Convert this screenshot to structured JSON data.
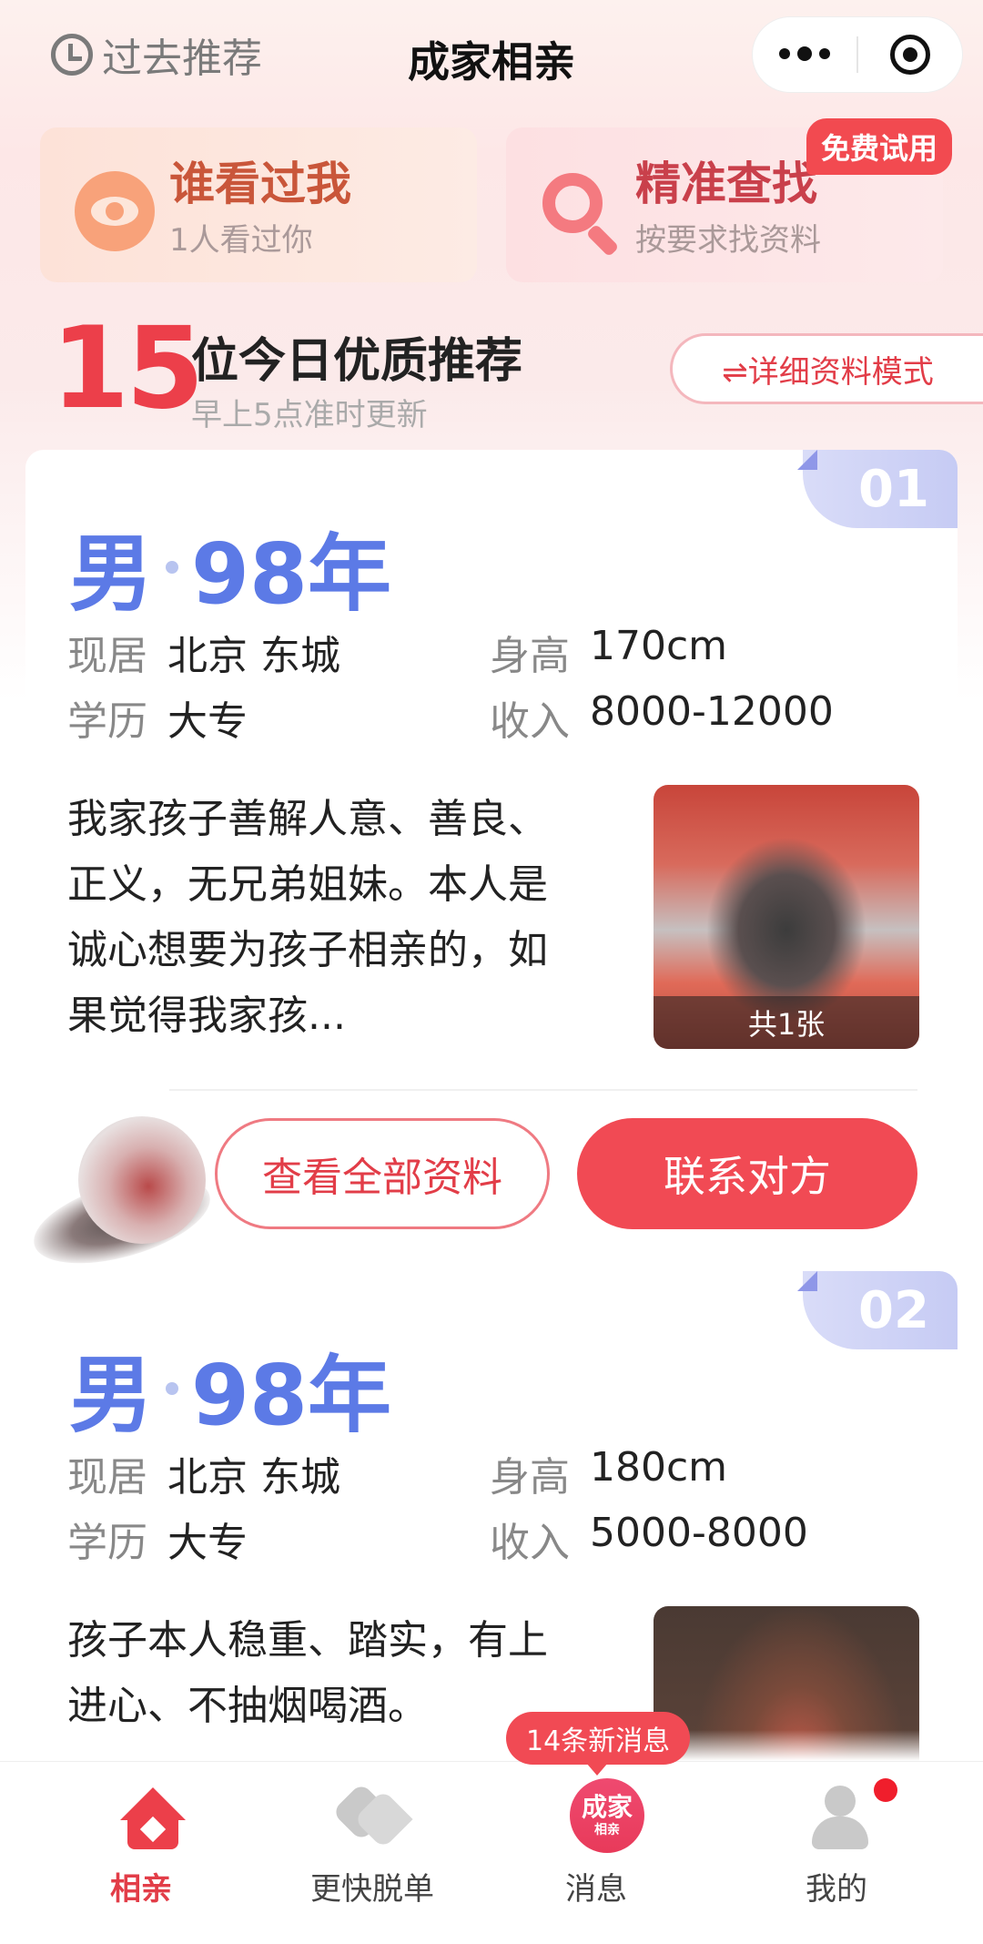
{
  "nav": {
    "past_label": "过去推荐",
    "title": "成家相亲",
    "more_icon": "more-dots-icon",
    "close_icon": "target-icon"
  },
  "features": [
    {
      "title": "谁看过我",
      "subtitle": "1人看过你",
      "icon": "eye-icon"
    },
    {
      "title": "精准查找",
      "subtitle": "按要求找资料",
      "icon": "search-icon",
      "badge": "免费试用"
    }
  ],
  "recommend": {
    "count": "15",
    "title": "位今日优质推荐",
    "subtitle": "早上5点准时更新",
    "mode_button": "⇌详细资料模式"
  },
  "profiles": [
    {
      "index": "01",
      "gender": "男",
      "year": "98年",
      "residence_label": "现居",
      "residence": "北京 东城",
      "height_label": "身高",
      "height": "170cm",
      "education_label": "学历",
      "education": "大专",
      "income_label": "收入",
      "income": "8000-12000",
      "description": "我家孩子善解人意、善良、正义，无兄弟姐妹。本人是诚心想要为孩子相亲的，如果觉得我家孩...",
      "photo_count": "共1张",
      "view_all_button": "查看全部资料",
      "contact_button": "联系对方"
    },
    {
      "index": "02",
      "gender": "男",
      "year": "98年",
      "residence_label": "现居",
      "residence": "北京 东城",
      "height_label": "身高",
      "height": "180cm",
      "education_label": "学历",
      "education": "大专",
      "income_label": "收入",
      "income": "5000-8000",
      "description": "孩子本人稳重、踏实，有上进心、不抽烟喝酒。"
    }
  ],
  "tabbar": {
    "tabs": [
      {
        "label": "相亲",
        "icon": "home-heart-icon",
        "active": true
      },
      {
        "label": "更快脱单",
        "icon": "hearts-icon",
        "active": false
      },
      {
        "label": "消息",
        "icon": "chengjia-logo-icon",
        "active": false
      },
      {
        "label": "我的",
        "icon": "person-icon",
        "active": false
      }
    ],
    "message_bubble": "14条新消息",
    "logo_text": "成家",
    "logo_subtext": "相亲"
  },
  "colors": {
    "accent": "#ec3f4a",
    "gender_blue": "#5c7ae6"
  }
}
